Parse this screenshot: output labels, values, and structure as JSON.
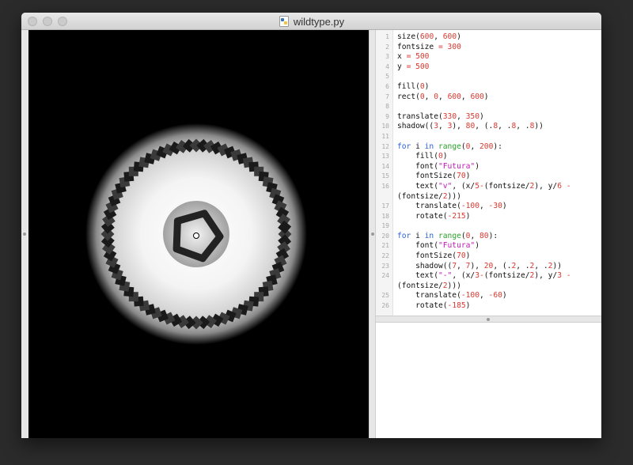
{
  "window": {
    "title": "wildtype.py",
    "file_icon": "python-file-icon",
    "traffic_lights": [
      "close-button",
      "minimize-button",
      "zoom-button"
    ]
  },
  "editor": {
    "lines": [
      {
        "n": "1",
        "text": "size(600, 600)"
      },
      {
        "n": "2",
        "text": "fontsize = 300"
      },
      {
        "n": "3",
        "text": "x = 500"
      },
      {
        "n": "4",
        "text": "y = 500"
      },
      {
        "n": "5",
        "text": ""
      },
      {
        "n": "6",
        "text": "fill(0)"
      },
      {
        "n": "7",
        "text": "rect(0, 0, 600, 600)"
      },
      {
        "n": "8",
        "text": ""
      },
      {
        "n": "9",
        "text": "translate(330, 350)"
      },
      {
        "n": "10",
        "text": "shadow((3, 3), 80, (.8, .8, .8))"
      },
      {
        "n": "11",
        "text": ""
      },
      {
        "n": "12",
        "text": "for i in range(0, 200):"
      },
      {
        "n": "13",
        "text": "    fill(0)"
      },
      {
        "n": "14",
        "text": "    font(\"Futura\")"
      },
      {
        "n": "15",
        "text": "    fontSize(70)"
      },
      {
        "n": "16",
        "text": "    text(\"v\", (x/5-(fontsize/2), y/6 -"
      },
      {
        "n": "",
        "text": "(fontsize/2)))"
      },
      {
        "n": "17",
        "text": "    translate(-100, -30)"
      },
      {
        "n": "18",
        "text": "    rotate(-215)"
      },
      {
        "n": "19",
        "text": ""
      },
      {
        "n": "20",
        "text": "for i in range(0, 80):"
      },
      {
        "n": "21",
        "text": "    font(\"Futura\")"
      },
      {
        "n": "22",
        "text": "    fontSize(70)"
      },
      {
        "n": "23",
        "text": "    shadow((7, 7), 20, (.2, .2, .2))"
      },
      {
        "n": "24",
        "text": "    text(\"-\", (x/3-(fontsize/2), y/3 -"
      },
      {
        "n": "",
        "text": "(fontsize/2)))"
      },
      {
        "n": "25",
        "text": "    translate(-100, -60)"
      },
      {
        "n": "26",
        "text": "    rotate(-185)"
      }
    ]
  },
  "colors": {
    "keyword": "#2a63d8",
    "builtin": "#2aa02a",
    "number": "#d9382f",
    "string": "#c219b8",
    "canvas_bg": "#000000"
  }
}
